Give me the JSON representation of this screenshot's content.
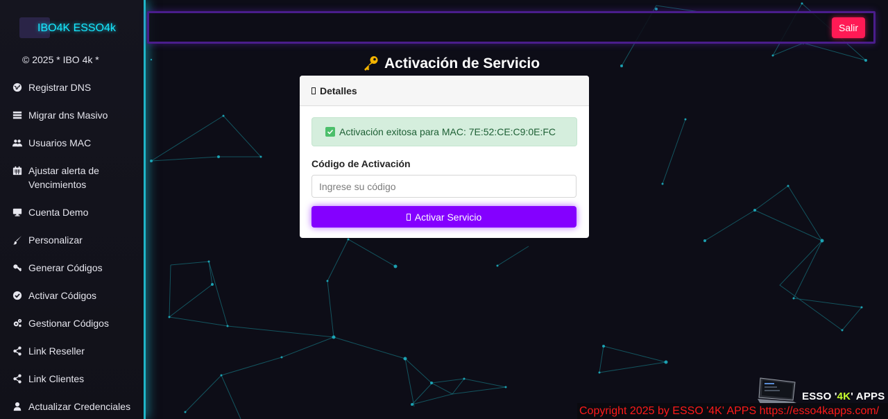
{
  "brand": {
    "name": "IBO4K ESSO4k",
    "copyright": "© 2025 * IBO 4k *"
  },
  "sidebar": {
    "items": [
      {
        "label": "Registrar DNS",
        "icon": "globe-icon"
      },
      {
        "label": "Migrar dns Masivo",
        "icon": "server-icon"
      },
      {
        "label": "Usuarios MAC",
        "icon": "users-icon"
      },
      {
        "label": "Ajustar alerta de Vencimientos",
        "icon": "calendar-icon"
      },
      {
        "label": "Cuenta Demo",
        "icon": "desktop-icon"
      },
      {
        "label": "Personalizar",
        "icon": "brush-icon"
      },
      {
        "label": "Generar Códigos",
        "icon": "key-icon"
      },
      {
        "label": "Activar Códigos",
        "icon": "check-circle-icon"
      },
      {
        "label": "Gestionar Códigos",
        "icon": "cogs-icon"
      },
      {
        "label": "Link Reseller",
        "icon": "share-icon"
      },
      {
        "label": "Link Clientes",
        "icon": "share-icon"
      },
      {
        "label": "Actualizar Credenciales",
        "icon": "user-icon"
      }
    ]
  },
  "header": {
    "logout_label": "Salir"
  },
  "main": {
    "title": "Activación de Servicio",
    "card": {
      "header": "Detalles",
      "alert": "Activación exitosa para MAC: 7E:52:CE:C9:0E:FC",
      "field_label": "Código de Activación",
      "input_placeholder": "Ingrese su código",
      "input_value": "",
      "button_label": "Activar Servicio"
    }
  },
  "footer": {
    "brand_prefix": "ESSO '",
    "brand_highlight": "4K",
    "brand_suffix": "' APPS",
    "copyright": "Copyright 2025  by ESSO '4K' APPS https://esso4kapps.com/"
  },
  "colors": {
    "accent_cyan": "#1fb6c8",
    "accent_purple": "#8400ff",
    "logout_red": "#ff1a55",
    "success_bg": "#d5eedd"
  }
}
